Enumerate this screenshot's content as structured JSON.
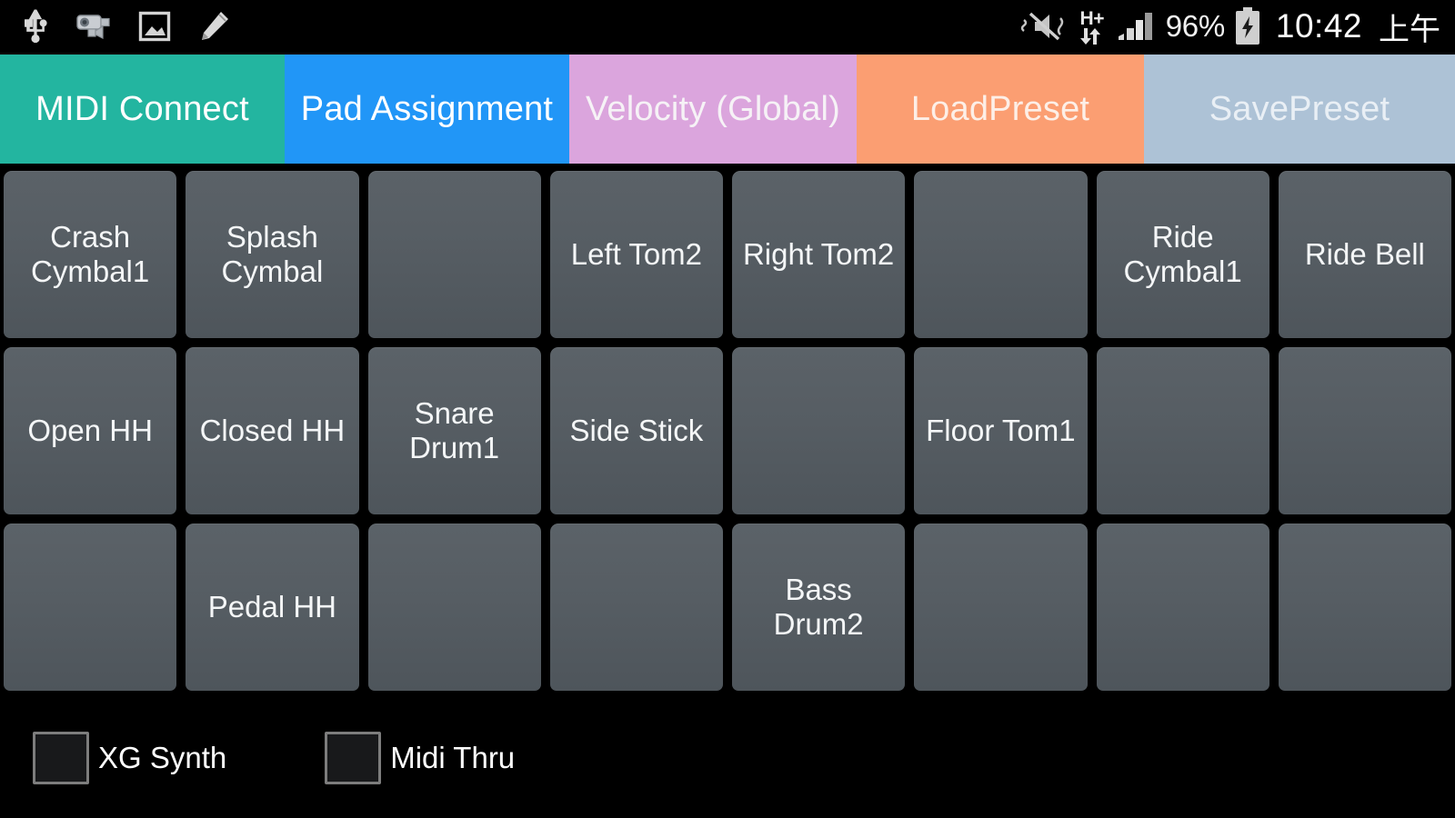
{
  "status_bar": {
    "left_icons": [
      {
        "name": "usb-icon",
        "glyph": "usb"
      },
      {
        "name": "screen-recorder-camera-icon",
        "glyph": "camera"
      },
      {
        "name": "screenshot-image-icon",
        "glyph": "image"
      },
      {
        "name": "edit-pencil-icon",
        "glyph": "pencil"
      }
    ],
    "right": {
      "sound_mode_icon": "mute-vibrate-icon",
      "network_type": "H+",
      "network_arrows_icon": "data-transfer-arrows-icon",
      "signal_icon": "signal-bars-icon",
      "battery_percent": "96%",
      "battery_icon": "battery-charging-icon",
      "clock": "10:42",
      "am_pm": "上午"
    }
  },
  "nav": {
    "buttons": [
      {
        "label": "MIDI Connect",
        "color": "#23b5a0",
        "key": "midi-connect"
      },
      {
        "label": "Pad Assignment",
        "color": "#2196f7",
        "key": "pad-assignment"
      },
      {
        "label": "Velocity (Global)",
        "color": "#dba5dd",
        "key": "velocity-global"
      },
      {
        "label": "LoadPreset",
        "color": "#fb9e72",
        "key": "load-preset"
      },
      {
        "label": "SavePreset",
        "color": "#adc2d6",
        "key": "save-preset"
      }
    ]
  },
  "pad_grid": {
    "rows": 3,
    "columns": 8,
    "pad_color": "#565d63",
    "pads": [
      "Crash Cymbal1",
      "Splash Cymbal",
      "",
      "Left Tom2",
      "Right Tom2",
      "",
      "Ride Cymbal1",
      "Ride Bell",
      "Open HH",
      "Closed HH",
      "Snare Drum1",
      "Side Stick",
      "",
      "Floor Tom1",
      "",
      "",
      "",
      "Pedal HH",
      "",
      "",
      "Bass Drum2",
      "",
      "",
      ""
    ]
  },
  "options": {
    "xg_synth": {
      "label": "XG Synth",
      "checked": false
    },
    "midi_thru": {
      "label": "Midi Thru",
      "checked": false
    }
  }
}
